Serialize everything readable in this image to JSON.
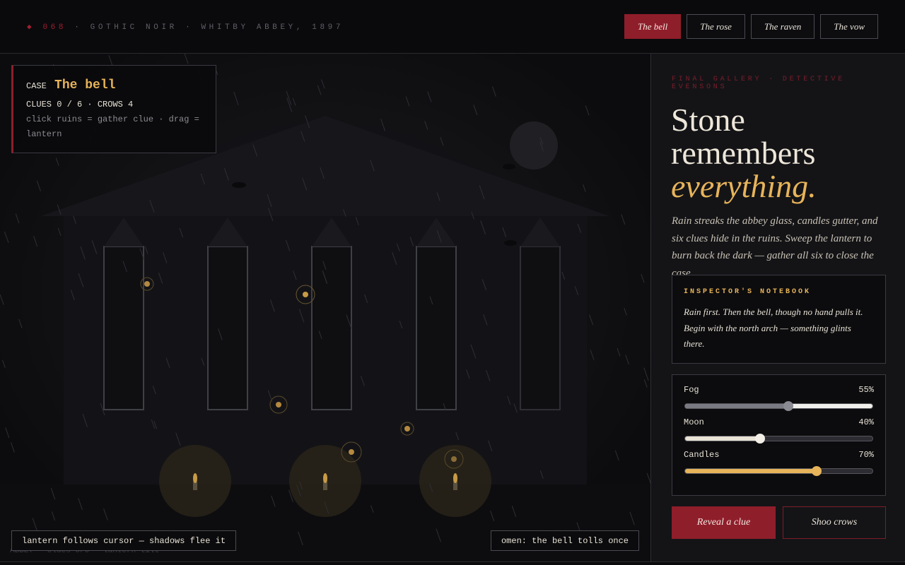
{
  "header": {
    "mark": "◆",
    "issue": "068",
    "label": "· GOTHIC NOIR · WHITBY ABBEY, 1897",
    "tabs": [
      {
        "label": "The bell",
        "active": true
      },
      {
        "label": "The rose",
        "active": false
      },
      {
        "label": "The raven",
        "active": false
      },
      {
        "label": "The vow",
        "active": false
      }
    ]
  },
  "case_card": {
    "prefix": "CASE",
    "name": "The bell",
    "counts": "CLUES 0 / 6 · CROWS 4",
    "hint": "click ruins = gather clue · drag = lantern"
  },
  "scene": {
    "status_left": "lantern follows cursor — shadows flee it",
    "status_right": "omen: the bell tolls once",
    "ghost_status": "ABBEY · clues 0/6 · lantern tilt",
    "colors": {
      "candle": "#c79a45",
      "clue": "#b5893f",
      "stone": "#3f3f46"
    }
  },
  "sidebar": {
    "eyebrow": "FINAL GALLERY · DETECTIVE EVENSONS",
    "headline_line1": "Stone",
    "headline_line2": "remembers",
    "headline_accent": "everything.",
    "intro": "Rain streaks the abbey glass, candles gutter, and six clues hide in the ruins. Sweep the lantern to burn back the dark — gather all six to close the case.",
    "notebook": {
      "title": "INSPECTOR'S NOTEBOOK",
      "text": "Rain first. Then the bell, though no hand pulls it. Begin with the north arch — something glints there."
    },
    "controls": [
      {
        "label": "Fog",
        "value_text": "55%",
        "value": 0.55,
        "fill": "#7a7a82",
        "thumb": "#8a8a92",
        "rest": "#f2f0ec"
      },
      {
        "label": "Moon",
        "value_text": "40%",
        "value": 0.4,
        "fill": "#e8e2d6",
        "thumb": "#f2eee6",
        "rest": "#2c2c32"
      },
      {
        "label": "Candles",
        "value_text": "70%",
        "value": 0.7,
        "fill": "#e7b45a",
        "thumb": "#e7b45a",
        "rest": "#2c2c32"
      }
    ],
    "buttons": {
      "primary": "Reveal a clue",
      "secondary": "Shoo crows"
    },
    "colors": {
      "accent": "#e7b45a",
      "crimson": "#8f1e2b"
    }
  }
}
